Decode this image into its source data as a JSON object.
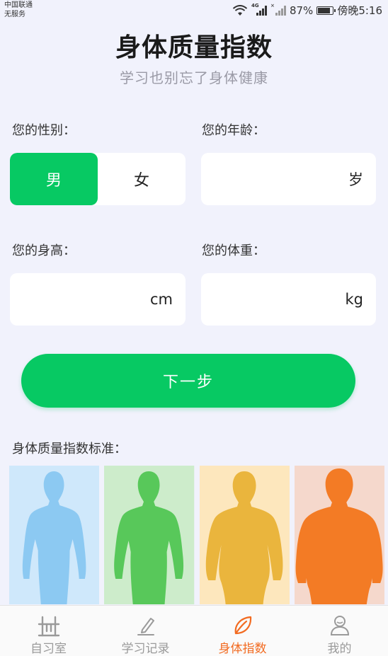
{
  "status_bar": {
    "carrier": "中国联通",
    "service": "无服务",
    "network": "4G",
    "battery": "87%",
    "battery_level": 0.87,
    "time": "傍晚5:16"
  },
  "header": {
    "title": "身体质量指数",
    "subtitle": "学习也别忘了身体健康"
  },
  "form": {
    "gender_label": "您的性别：",
    "gender_options": [
      "男",
      "女"
    ],
    "gender_selected": "男",
    "age_label": "您的年龄：",
    "age_unit": "岁",
    "height_label": "您的身高：",
    "height_unit": "cm",
    "weight_label": "您的体重：",
    "weight_unit": "kg"
  },
  "next_button": "下一步",
  "bmi_standard": {
    "label": "身体质量指数标准：",
    "panels": [
      {
        "bg": "#cfe8fb",
        "figure": "#8cc9f2"
      },
      {
        "bg": "#cdeccb",
        "figure": "#58c85a"
      },
      {
        "bg": "#fde7bd",
        "figure": "#eab53d"
      },
      {
        "bg": "#f5d8cc",
        "figure": "#f37b25"
      }
    ]
  },
  "colors": {
    "accent": "#07c963",
    "active_tab": "#f26b21"
  },
  "bottom_nav": {
    "items": [
      {
        "label": "自习室",
        "icon": "desk-icon"
      },
      {
        "label": "学习记录",
        "icon": "pencil-icon"
      },
      {
        "label": "身体指数",
        "icon": "leaf-icon"
      },
      {
        "label": "我的",
        "icon": "user-icon"
      }
    ],
    "active": 2
  }
}
